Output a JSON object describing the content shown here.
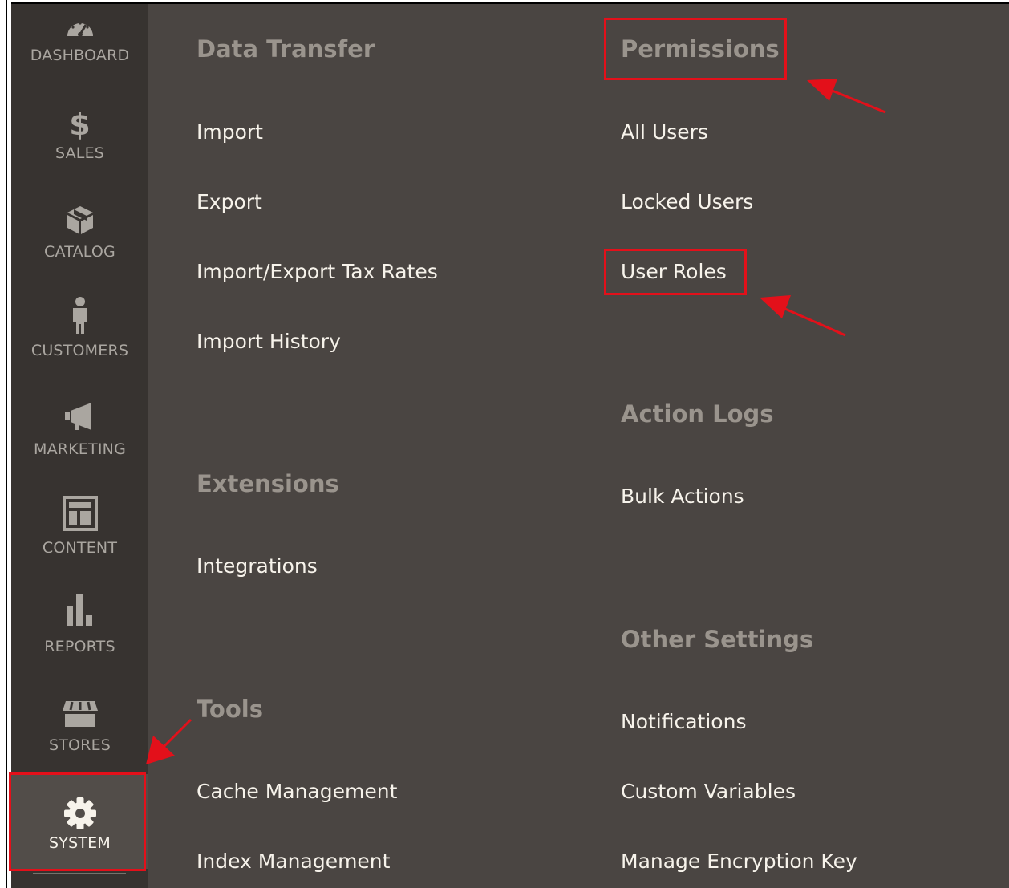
{
  "sidebar": {
    "items": [
      {
        "label": "DASHBOARD",
        "icon": "dashboard-gauge-icon"
      },
      {
        "label": "SALES",
        "icon": "dollar-icon"
      },
      {
        "label": "CATALOG",
        "icon": "box-icon"
      },
      {
        "label": "CUSTOMERS",
        "icon": "person-icon"
      },
      {
        "label": "MARKETING",
        "icon": "megaphone-icon"
      },
      {
        "label": "CONTENT",
        "icon": "layout-icon"
      },
      {
        "label": "REPORTS",
        "icon": "bar-chart-icon"
      },
      {
        "label": "STORES",
        "icon": "storefront-icon"
      },
      {
        "label": "SYSTEM",
        "icon": "gear-icon",
        "active": true
      }
    ]
  },
  "menu": {
    "left": {
      "data_transfer": {
        "title": "Data Transfer",
        "links": [
          "Import",
          "Export",
          "Import/Export Tax Rates",
          "Import History"
        ]
      },
      "extensions": {
        "title": "Extensions",
        "links": [
          "Integrations"
        ]
      },
      "tools": {
        "title": "Tools",
        "links": [
          "Cache Management",
          "Index Management"
        ]
      }
    },
    "right": {
      "permissions": {
        "title": "Permissions",
        "links": [
          "All Users",
          "Locked Users",
          "User Roles"
        ]
      },
      "action_logs": {
        "title": "Action Logs",
        "links": [
          "Bulk Actions"
        ]
      },
      "other_settings": {
        "title": "Other Settings",
        "links": [
          "Notifications",
          "Custom Variables",
          "Manage Encryption Key"
        ]
      }
    }
  },
  "colors": {
    "sidebar_bg": "#373330",
    "panel_bg": "#4a4542",
    "heading": "#9a948d",
    "link": "#f7f3eb",
    "annotation": "#e3101a"
  }
}
